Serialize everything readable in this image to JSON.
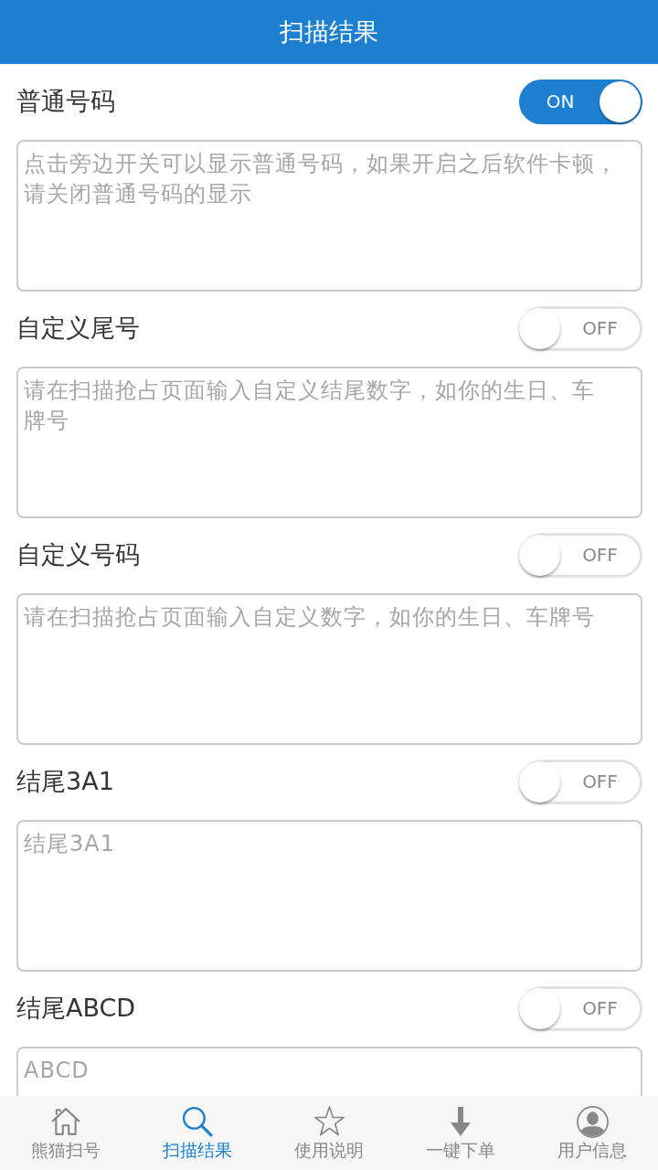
{
  "header": {
    "title": "扫描结果"
  },
  "sections": [
    {
      "label": "普通号码",
      "toggle": {
        "on": true,
        "text": "ON"
      },
      "field": {
        "placeholder": "点击旁边开关可以显示普通号码，如果开启之后软件卡顿，请关闭普通号码的显示"
      }
    },
    {
      "label": "自定义尾号",
      "toggle": {
        "on": false,
        "text": "OFF"
      },
      "field": {
        "placeholder": "请在扫描抢占页面输入自定义结尾数字，如你的生日、车牌号"
      }
    },
    {
      "label": "自定义号码",
      "toggle": {
        "on": false,
        "text": "OFF"
      },
      "field": {
        "placeholder": "请在扫描抢占页面输入自定义数字，如你的生日、车牌号"
      }
    },
    {
      "label": "结尾3A1",
      "toggle": {
        "on": false,
        "text": "OFF"
      },
      "field": {
        "placeholder": "结尾3A1"
      }
    },
    {
      "label": "结尾ABCD",
      "toggle": {
        "on": false,
        "text": "OFF"
      },
      "field": {
        "placeholder": "ABCD"
      }
    }
  ],
  "tab_bar": [
    {
      "label": "熊猫扫号",
      "selected": false
    },
    {
      "label": "扫描结果",
      "selected": true
    },
    {
      "label": "使用说明",
      "selected": false
    },
    {
      "label": "一键下单",
      "selected": false
    },
    {
      "label": "用户信息",
      "selected": false
    }
  ]
}
